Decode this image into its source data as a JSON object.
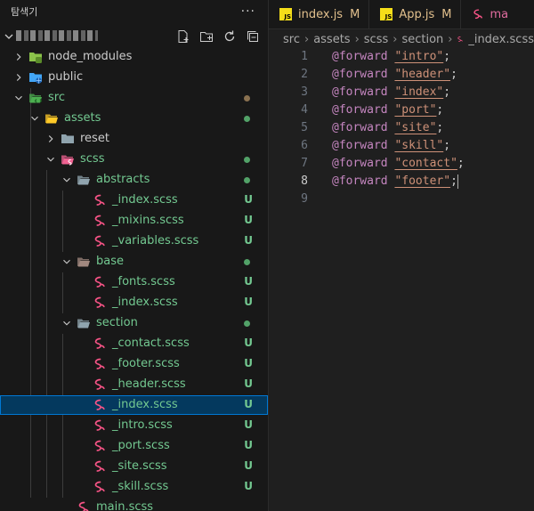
{
  "explorer": {
    "title": "탐색기",
    "more": "···",
    "tree": [
      {
        "label": "node_modules",
        "type": "folder",
        "icon": "node",
        "depth": 1,
        "open": false
      },
      {
        "label": "public",
        "type": "folder",
        "icon": "public",
        "depth": 1,
        "open": false
      },
      {
        "label": "src",
        "type": "folder",
        "icon": "src",
        "depth": 1,
        "open": true,
        "dot": "brown"
      },
      {
        "label": "assets",
        "type": "folder",
        "icon": "assets",
        "depth": 2,
        "open": true,
        "dot": "green"
      },
      {
        "label": "reset",
        "type": "folder",
        "icon": "plain",
        "depth": 3,
        "open": false
      },
      {
        "label": "scss",
        "type": "folder",
        "icon": "scss",
        "depth": 3,
        "open": true,
        "dot": "green"
      },
      {
        "label": "abstracts",
        "type": "folder",
        "icon": "plain",
        "depth": 4,
        "open": true,
        "dot": "green"
      },
      {
        "label": "_index.scss",
        "type": "file",
        "depth": 5,
        "badge": "U"
      },
      {
        "label": "_mixins.scss",
        "type": "file",
        "depth": 5,
        "badge": "U"
      },
      {
        "label": "_variables.scss",
        "type": "file",
        "depth": 5,
        "badge": "U"
      },
      {
        "label": "base",
        "type": "folder",
        "icon": "base",
        "depth": 4,
        "open": true,
        "dot": "green"
      },
      {
        "label": "_fonts.scss",
        "type": "file",
        "depth": 5,
        "badge": "U"
      },
      {
        "label": "_index.scss",
        "type": "file",
        "depth": 5,
        "badge": "U"
      },
      {
        "label": "section",
        "type": "folder",
        "icon": "plain",
        "depth": 4,
        "open": true,
        "dot": "green"
      },
      {
        "label": "_contact.scss",
        "type": "file",
        "depth": 5,
        "badge": "U"
      },
      {
        "label": "_footer.scss",
        "type": "file",
        "depth": 5,
        "badge": "U"
      },
      {
        "label": "_header.scss",
        "type": "file",
        "depth": 5,
        "badge": "U"
      },
      {
        "label": "_index.scss",
        "type": "file",
        "depth": 5,
        "badge": "U",
        "selected": true
      },
      {
        "label": "_intro.scss",
        "type": "file",
        "depth": 5,
        "badge": "U"
      },
      {
        "label": "_port.scss",
        "type": "file",
        "depth": 5,
        "badge": "U"
      },
      {
        "label": "_site.scss",
        "type": "file",
        "depth": 5,
        "badge": "U"
      },
      {
        "label": "_skill.scss",
        "type": "file",
        "depth": 5,
        "badge": "U"
      },
      {
        "label": "main.scss",
        "type": "file",
        "depth": 4,
        "badge": ""
      }
    ]
  },
  "tabs": [
    {
      "name": "index.js",
      "status": "M",
      "icon": "js-icon"
    },
    {
      "name": "App.js",
      "status": "M",
      "icon": "js-icon"
    },
    {
      "name": "ma",
      "status": "",
      "icon": "scss-icon"
    }
  ],
  "breadcrumb": {
    "parts": [
      "src",
      "assets",
      "scss",
      "section"
    ],
    "file": "_index.scss"
  },
  "code": [
    {
      "n": "1",
      "kw": "@forward",
      "str": "\"intro\"",
      "end": ";"
    },
    {
      "n": "2",
      "kw": "@forward",
      "str": "\"header\"",
      "end": ";"
    },
    {
      "n": "3",
      "kw": "@forward",
      "str": "\"index\"",
      "end": ";"
    },
    {
      "n": "4",
      "kw": "@forward",
      "str": "\"port\"",
      "end": ";"
    },
    {
      "n": "5",
      "kw": "@forward",
      "str": "\"site\"",
      "end": ";"
    },
    {
      "n": "6",
      "kw": "@forward",
      "str": "\"skill\"",
      "end": ";"
    },
    {
      "n": "7",
      "kw": "@forward",
      "str": "\"contact\"",
      "end": ";"
    },
    {
      "n": "8",
      "kw": "@forward",
      "str": "\"footer\"",
      "end": ";",
      "current": true
    },
    {
      "n": "9",
      "kw": "",
      "str": "",
      "end": ""
    }
  ],
  "colors": {
    "accent": "#0078d4",
    "untracked": "#73c991",
    "modified": "#e2c08d",
    "selection": "#04395e"
  }
}
